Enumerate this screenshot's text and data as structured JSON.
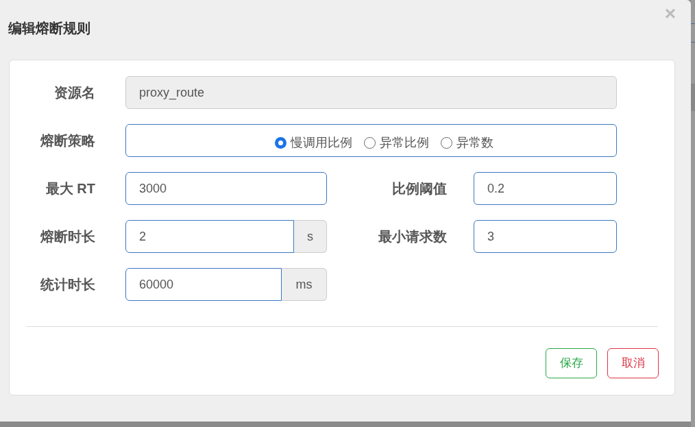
{
  "dialog": {
    "title": "编辑熔断规则",
    "close": "×"
  },
  "form": {
    "resource": {
      "label": "资源名",
      "value": "proxy_route",
      "disabled": true
    },
    "strategy": {
      "label": "熔断策略",
      "options": [
        {
          "label": "慢调用比例",
          "selected": true
        },
        {
          "label": "异常比例",
          "selected": false
        },
        {
          "label": "异常数",
          "selected": false
        }
      ]
    },
    "max_rt": {
      "label": "最大 RT",
      "value": "3000"
    },
    "ratio_threshold": {
      "label": "比例阈值",
      "value": "0.2"
    },
    "duration": {
      "label": "熔断时长",
      "value": "2",
      "unit": "s"
    },
    "min_requests": {
      "label": "最小请求数",
      "value": "3"
    },
    "stat_interval": {
      "label": "统计时长",
      "value": "60000",
      "unit": "ms"
    }
  },
  "buttons": [
    {
      "kind": "save",
      "label": "保存"
    },
    {
      "kind": "cancel",
      "label": "取消"
    }
  ]
}
